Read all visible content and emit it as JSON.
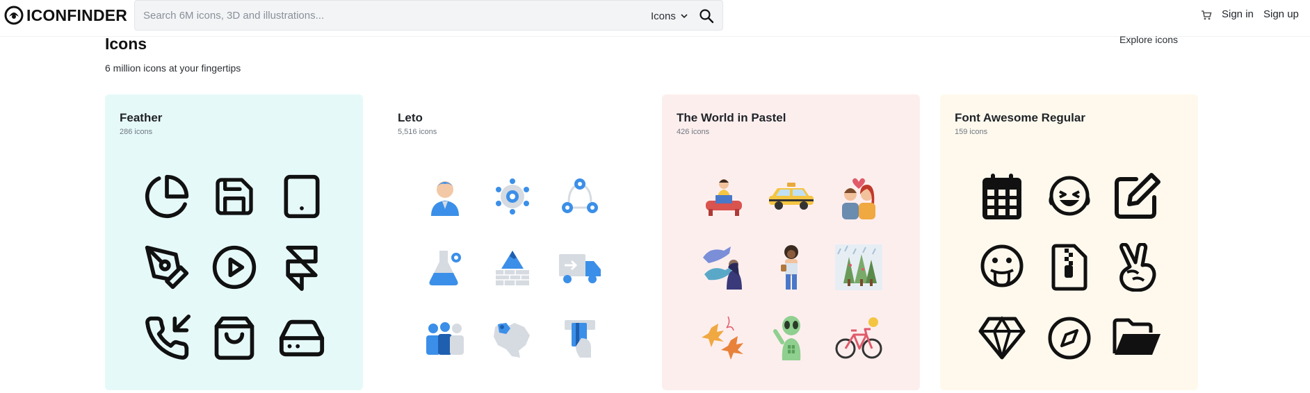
{
  "header": {
    "logo_text": "ICONFINDER",
    "search_placeholder": "Search 6M icons, 3D and illustrations...",
    "search_type": "Icons",
    "sign_in": "Sign in",
    "sign_up": "Sign up"
  },
  "page": {
    "title": "Icons",
    "subtitle": "6 million icons at your fingertips",
    "explore_link": "Explore icons"
  },
  "cards": [
    {
      "title": "Feather",
      "count": "286 icons",
      "bg": "#e6f9f9",
      "icons": [
        "pie-chart-icon",
        "save-icon",
        "tablet-icon",
        "pen-tool-icon",
        "play-circle-icon",
        "framer-icon",
        "phone-incoming-icon",
        "shopping-bag-icon",
        "hard-drive-icon"
      ]
    },
    {
      "title": "Leto",
      "count": "5,516 icons",
      "bg": "#ffffff",
      "icons": [
        "user-avatar-icon",
        "settings-network-icon",
        "workflow-icon",
        "chemistry-flask-icon",
        "mountain-wall-icon",
        "delivery-truck-icon",
        "team-group-icon",
        "world-map-icon",
        "atm-card-icon"
      ]
    },
    {
      "title": "The World in Pastel",
      "count": "426 icons",
      "bg": "#fdeeee",
      "icons": [
        "person-laptop-icon",
        "taxi-icon",
        "couple-love-icon",
        "whales-woman-icon",
        "woman-standing-icon",
        "rainy-forest-icon",
        "autumn-leaves-icon",
        "alien-icon",
        "bicycle-icon"
      ]
    },
    {
      "title": "Font Awesome Regular",
      "count": "159 icons",
      "bg": "#fff9ed",
      "icons": [
        "calendar-icon",
        "laugh-squint-icon",
        "edit-icon",
        "grin-tongue-icon",
        "file-archive-icon",
        "hand-peace-icon",
        "gem-icon",
        "compass-icon",
        "folder-open-icon"
      ]
    }
  ],
  "colors": {
    "leto_blue": "#3b8fe8",
    "leto_gray": "#d6dbe1",
    "feather_stroke": "#111111"
  }
}
